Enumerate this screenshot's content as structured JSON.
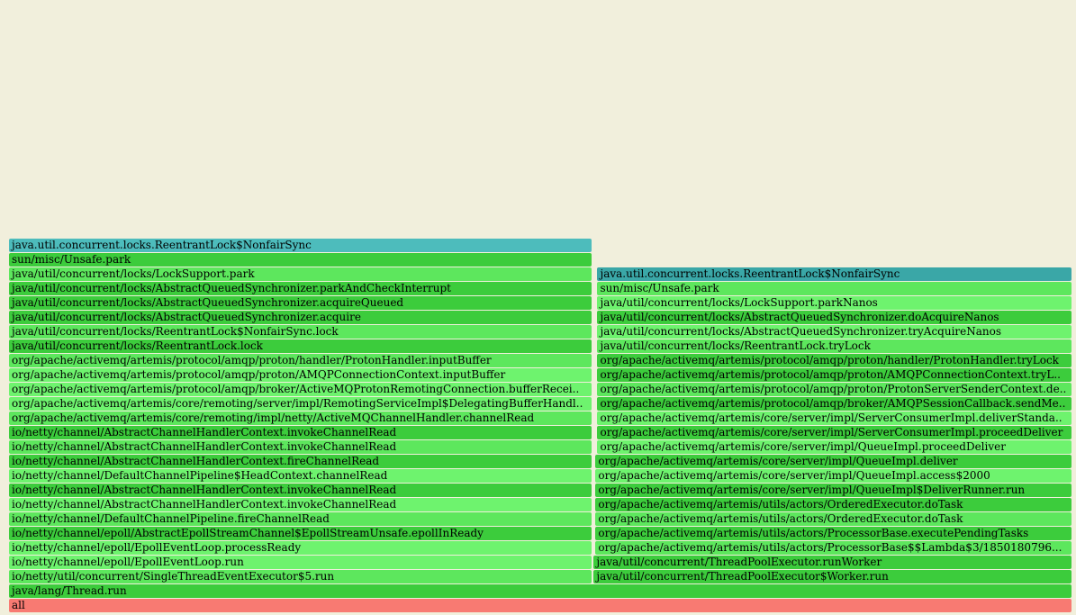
{
  "colors": {
    "background": "#f1efdc",
    "root": "#f87a72",
    "java_green": "#5de75d",
    "java_green_dark": "#3ccc3c",
    "java_green_light": "#6ef36e",
    "lock_cyan": "#4dbcbc",
    "lock_teal": "#3aa7a7"
  },
  "frames": [
    {
      "id": "f0",
      "label": "all",
      "depth": 0,
      "start": 0,
      "end": 1,
      "color": "#f87a72"
    },
    {
      "id": "f1",
      "label": "java/lang/Thread.run",
      "depth": 1,
      "start": 0,
      "end": 1,
      "color": "#3ccc3c"
    },
    {
      "id": "f2",
      "label": "io/netty/util/concurrent/SingleThreadEventExecutor$5.run",
      "depth": 2,
      "start": 0,
      "end": 0.5486,
      "color": "#5de75d"
    },
    {
      "id": "f3",
      "label": "io/netty/channel/epoll/EpollEventLoop.run",
      "depth": 3,
      "start": 0,
      "end": 0.5486,
      "color": "#6ef36e"
    },
    {
      "id": "f4",
      "label": "io/netty/channel/epoll/EpollEventLoop.processReady",
      "depth": 4,
      "start": 0,
      "end": 0.5486,
      "color": "#6ef36e"
    },
    {
      "id": "f5",
      "label": "io/netty/channel/epoll/AbstractEpollStreamChannel$EpollStreamUnsafe.epollInReady",
      "depth": 5,
      "start": 0,
      "end": 0.5486,
      "color": "#3ccc3c"
    },
    {
      "id": "f6",
      "label": "io/netty/channel/DefaultChannelPipeline.fireChannelRead",
      "depth": 6,
      "start": 0,
      "end": 0.5486,
      "color": "#5de75d"
    },
    {
      "id": "f7",
      "label": "io/netty/channel/AbstractChannelHandlerContext.invokeChannelRead",
      "depth": 7,
      "start": 0,
      "end": 0.5486,
      "color": "#6ef36e"
    },
    {
      "id": "f8",
      "label": "io/netty/channel/AbstractChannelHandlerContext.invokeChannelRead",
      "depth": 8,
      "start": 0,
      "end": 0.5486,
      "color": "#3ccc3c"
    },
    {
      "id": "f9",
      "label": "io/netty/channel/DefaultChannelPipeline$HeadContext.channelRead",
      "depth": 9,
      "start": 0,
      "end": 0.5486,
      "color": "#6ef36e"
    },
    {
      "id": "f10",
      "label": "io/netty/channel/AbstractChannelHandlerContext.fireChannelRead",
      "depth": 10,
      "start": 0,
      "end": 0.5486,
      "color": "#3ccc3c"
    },
    {
      "id": "f11",
      "label": "io/netty/channel/AbstractChannelHandlerContext.invokeChannelRead",
      "depth": 11,
      "start": 0,
      "end": 0.5486,
      "color": "#5de75d"
    },
    {
      "id": "f12",
      "label": "io/netty/channel/AbstractChannelHandlerContext.invokeChannelRead",
      "depth": 12,
      "start": 0,
      "end": 0.5486,
      "color": "#3ccc3c"
    },
    {
      "id": "f13",
      "label": "org/apache/activemq/artemis/core/remoting/impl/netty/ActiveMQChannelHandler.channelRead",
      "depth": 13,
      "start": 0,
      "end": 0.5486,
      "color": "#5de75d"
    },
    {
      "id": "f14",
      "label": "org/apache/activemq/artemis/core/remoting/server/impl/RemotingServiceImpl$DelegatingBufferHandl..",
      "depth": 14,
      "start": 0,
      "end": 0.5486,
      "color": "#6ef36e"
    },
    {
      "id": "f15",
      "label": "org/apache/activemq/artemis/protocol/amqp/broker/ActiveMQProtonRemotingConnection.bufferRecei..",
      "depth": 15,
      "start": 0,
      "end": 0.5486,
      "color": "#6ef36e"
    },
    {
      "id": "f16",
      "label": "org/apache/activemq/artemis/protocol/amqp/proton/AMQPConnectionContext.inputBuffer",
      "depth": 16,
      "start": 0,
      "end": 0.5486,
      "color": "#6ef36e"
    },
    {
      "id": "f17",
      "label": "org/apache/activemq/artemis/protocol/amqp/proton/handler/ProtonHandler.inputBuffer",
      "depth": 17,
      "start": 0,
      "end": 0.5486,
      "color": "#5de75d"
    },
    {
      "id": "f18",
      "label": "java/util/concurrent/locks/ReentrantLock.lock",
      "depth": 18,
      "start": 0,
      "end": 0.5486,
      "color": "#3ccc3c"
    },
    {
      "id": "f19",
      "label": "java/util/concurrent/locks/ReentrantLock$NonfairSync.lock",
      "depth": 19,
      "start": 0,
      "end": 0.5486,
      "color": "#5de75d"
    },
    {
      "id": "f20",
      "label": "java/util/concurrent/locks/AbstractQueuedSynchronizer.acquire",
      "depth": 20,
      "start": 0,
      "end": 0.5486,
      "color": "#3ccc3c"
    },
    {
      "id": "f21",
      "label": "java/util/concurrent/locks/AbstractQueuedSynchronizer.acquireQueued",
      "depth": 21,
      "start": 0,
      "end": 0.5486,
      "color": "#3ccc3c"
    },
    {
      "id": "f22",
      "label": "java/util/concurrent/locks/AbstractQueuedSynchronizer.parkAndCheckInterrupt",
      "depth": 22,
      "start": 0,
      "end": 0.5486,
      "color": "#3ccc3c"
    },
    {
      "id": "f23",
      "label": "java/util/concurrent/locks/LockSupport.park",
      "depth": 23,
      "start": 0,
      "end": 0.5486,
      "color": "#5de75d"
    },
    {
      "id": "f24",
      "label": "sun/misc/Unsafe.park",
      "depth": 24,
      "start": 0,
      "end": 0.5486,
      "color": "#3ccc3c"
    },
    {
      "id": "f25",
      "label": "java.util.concurrent.locks.ReentrantLock$NonfairSync",
      "depth": 25,
      "start": 0,
      "end": 0.5486,
      "color": "#4dbcbc"
    },
    {
      "id": "f26",
      "label": "java/util/concurrent/ThreadPoolExecutor$Worker.run",
      "depth": 2,
      "start": 0.5486,
      "end": 1,
      "color": "#3ccc3c"
    },
    {
      "id": "f27",
      "label": "java/util/concurrent/ThreadPoolExecutor.runWorker",
      "depth": 3,
      "start": 0.5486,
      "end": 1,
      "color": "#3ccc3c"
    },
    {
      "id": "f28",
      "label": "org/apache/activemq/artemis/utils/actors/ProcessorBase$$Lambda$3/1850180796...",
      "depth": 4,
      "start": 0.5503,
      "end": 1,
      "color": "#5de75d"
    },
    {
      "id": "f29",
      "label": "org/apache/activemq/artemis/utils/actors/ProcessorBase.executePendingTasks",
      "depth": 5,
      "start": 0.5503,
      "end": 1,
      "color": "#3ccc3c"
    },
    {
      "id": "f30",
      "label": "org/apache/activemq/artemis/utils/actors/OrderedExecutor.doTask",
      "depth": 6,
      "start": 0.5503,
      "end": 1,
      "color": "#5de75d"
    },
    {
      "id": "f31",
      "label": "org/apache/activemq/artemis/utils/actors/OrderedExecutor.doTask",
      "depth": 7,
      "start": 0.5503,
      "end": 1,
      "color": "#3ccc3c"
    },
    {
      "id": "f32",
      "label": "org/apache/activemq/artemis/core/server/impl/QueueImpl$DeliverRunner.run",
      "depth": 8,
      "start": 0.5503,
      "end": 1,
      "color": "#3ccc3c"
    },
    {
      "id": "f33",
      "label": "org/apache/activemq/artemis/core/server/impl/QueueImpl.access$2000",
      "depth": 9,
      "start": 0.5503,
      "end": 1,
      "color": "#6ef36e"
    },
    {
      "id": "f34",
      "label": "org/apache/activemq/artemis/core/server/impl/QueueImpl.deliver",
      "depth": 10,
      "start": 0.5503,
      "end": 1,
      "color": "#3ccc3c"
    },
    {
      "id": "f35",
      "label": "org/apache/activemq/artemis/core/server/impl/QueueImpl.proceedDeliver",
      "depth": 11,
      "start": 0.5521,
      "end": 1,
      "color": "#6ef36e"
    },
    {
      "id": "f36",
      "label": "org/apache/activemq/artemis/core/server/impl/ServerConsumerImpl.proceedDeliver",
      "depth": 12,
      "start": 0.5521,
      "end": 1,
      "color": "#3ccc3c"
    },
    {
      "id": "f37",
      "label": "org/apache/activemq/artemis/core/server/impl/ServerConsumerImpl.deliverStanda..",
      "depth": 13,
      "start": 0.5521,
      "end": 1,
      "color": "#6ef36e"
    },
    {
      "id": "f38",
      "label": "org/apache/activemq/artemis/protocol/amqp/broker/AMQPSessionCallback.sendMe..",
      "depth": 14,
      "start": 0.5521,
      "end": 1,
      "color": "#3ccc3c"
    },
    {
      "id": "f39",
      "label": "org/apache/activemq/artemis/protocol/amqp/proton/ProtonServerSenderContext.de..",
      "depth": 15,
      "start": 0.5521,
      "end": 1,
      "color": "#5de75d"
    },
    {
      "id": "f40",
      "label": "org/apache/activemq/artemis/protocol/amqp/proton/AMQPConnectionContext.tryL..",
      "depth": 16,
      "start": 0.5521,
      "end": 1,
      "color": "#3ccc3c"
    },
    {
      "id": "f41",
      "label": "org/apache/activemq/artemis/protocol/amqp/proton/handler/ProtonHandler.tryLock",
      "depth": 17,
      "start": 0.5521,
      "end": 1,
      "color": "#3ccc3c"
    },
    {
      "id": "f42",
      "label": "java/util/concurrent/locks/ReentrantLock.tryLock",
      "depth": 18,
      "start": 0.5521,
      "end": 1,
      "color": "#5de75d"
    },
    {
      "id": "f43",
      "label": "java/util/concurrent/locks/AbstractQueuedSynchronizer.tryAcquireNanos",
      "depth": 19,
      "start": 0.5521,
      "end": 1,
      "color": "#6ef36e"
    },
    {
      "id": "f44",
      "label": "java/util/concurrent/locks/AbstractQueuedSynchronizer.doAcquireNanos",
      "depth": 20,
      "start": 0.5521,
      "end": 1,
      "color": "#3ccc3c"
    },
    {
      "id": "f45",
      "label": "java/util/concurrent/locks/LockSupport.parkNanos",
      "depth": 21,
      "start": 0.5521,
      "end": 1,
      "color": "#6ef36e"
    },
    {
      "id": "f46",
      "label": "sun/misc/Unsafe.park",
      "depth": 22,
      "start": 0.5521,
      "end": 1,
      "color": "#5de75d"
    },
    {
      "id": "f47",
      "label": "java.util.concurrent.locks.ReentrantLock$NonfairSync",
      "depth": 23,
      "start": 0.5521,
      "end": 1,
      "color": "#3aa7a7"
    }
  ]
}
